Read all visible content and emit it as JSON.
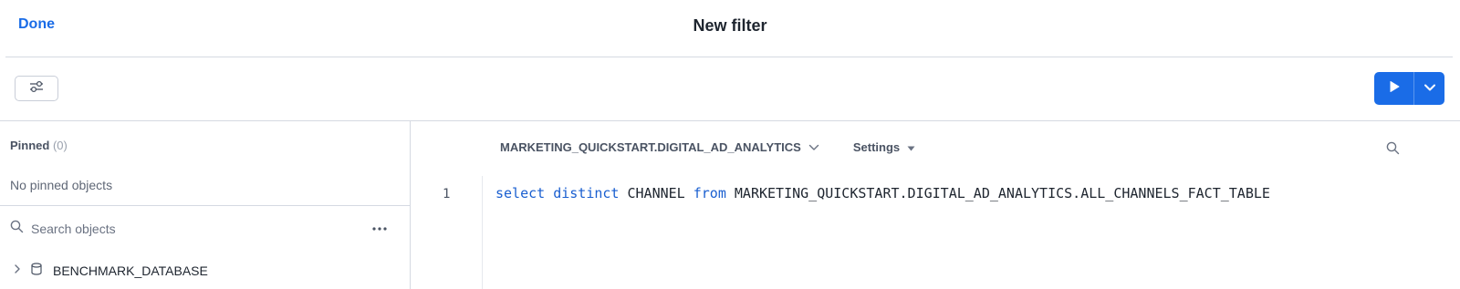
{
  "header": {
    "done_label": "Done",
    "title": "New filter"
  },
  "toolbar": {
    "filter_icon": "sliders-icon",
    "run_icon": "play-icon",
    "run_menu_icon": "chevron-down-icon",
    "accent": "#1a6ce7"
  },
  "sidebar": {
    "pinned_label": "Pinned",
    "pinned_count": "(0)",
    "pinned_empty": "No pinned objects",
    "search_placeholder": "Search objects",
    "tree": [
      {
        "label": "BENCHMARK_DATABASE",
        "icon": "database-icon"
      }
    ]
  },
  "editor": {
    "context": "MARKETING_QUICKSTART.DIGITAL_AD_ANALYTICS",
    "settings_label": "Settings",
    "line_number": "1",
    "code_tokens": {
      "kw1": "select",
      "kw2": "distinct",
      "ident1": "CHANNEL",
      "kw3": "from",
      "ident2": "MARKETING_QUICKSTART.DIGITAL_AD_ANALYTICS.ALL_CHANNELS_FACT_TABLE"
    }
  }
}
